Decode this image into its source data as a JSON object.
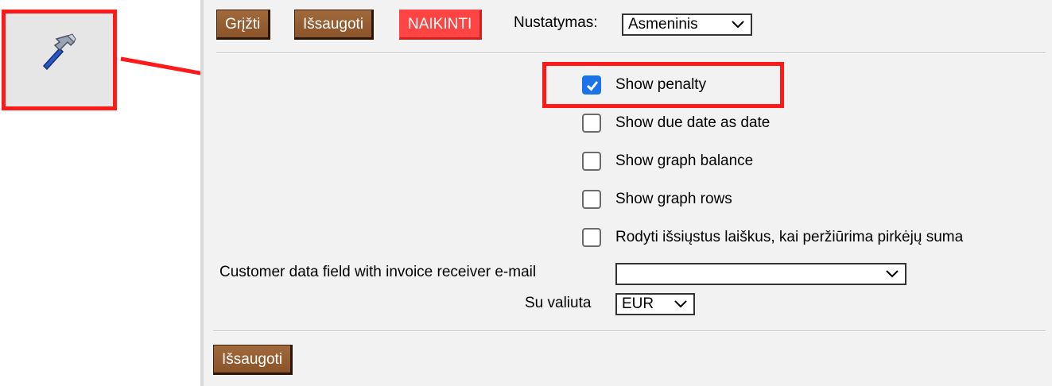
{
  "toolbar": {
    "back_label": "Grįžti",
    "save_label": "Išsaugoti",
    "delete_label": "NAIKINTI",
    "setting_label": "Nustatymas:",
    "setting_value": "Asmeninis"
  },
  "options": [
    {
      "label": "Show penalty",
      "checked": true
    },
    {
      "label": "Show due date as date",
      "checked": false
    },
    {
      "label": "Show graph balance",
      "checked": false
    },
    {
      "label": "Show graph rows",
      "checked": false
    },
    {
      "label": "Rodyti išsiųstus laiškus, kai peržiūrima pirkėjų suma",
      "checked": false
    }
  ],
  "fields": {
    "email_field_label": "Customer data field with invoice receiver e-mail",
    "email_field_value": "",
    "currency_label": "Su valiuta",
    "currency_value": "EUR"
  },
  "footer": {
    "save_label": "Išsaugoti"
  },
  "colors": {
    "button_brown": "#8b5328",
    "button_danger": "#ff4444",
    "checkbox_blue": "#1a73e8",
    "highlight_red": "#ff1a1a"
  },
  "icons": [
    "hammer-icon",
    "arrow-icon",
    "chevron-down-icon",
    "checkmark-icon"
  ]
}
